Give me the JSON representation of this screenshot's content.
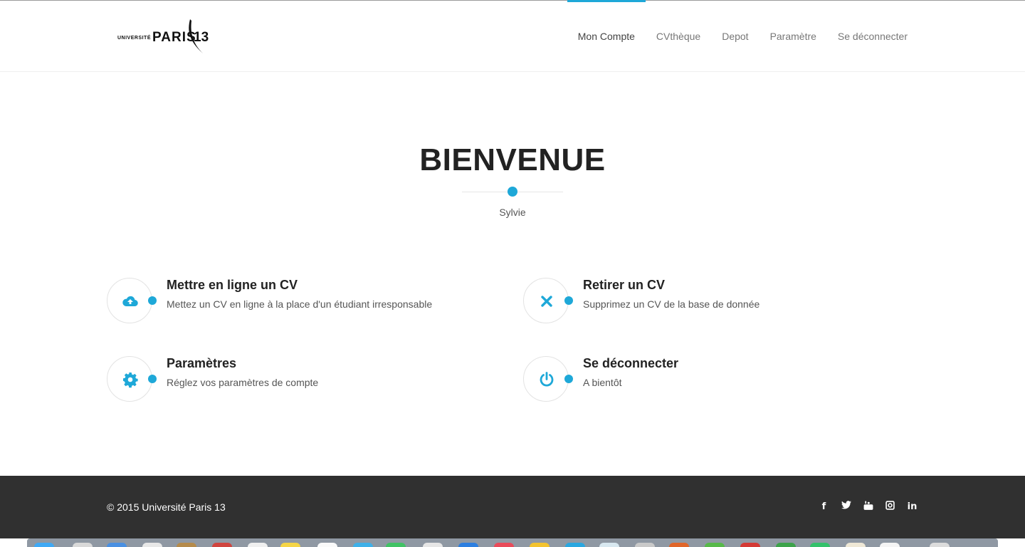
{
  "header": {
    "logo_small": "UNIVERSITÉ",
    "logo_big": "PARIS",
    "logo_num": "13",
    "nav": [
      {
        "label": "Mon Compte",
        "active": true
      },
      {
        "label": "CVthèque",
        "active": false
      },
      {
        "label": "Depot",
        "active": false
      },
      {
        "label": "Paramètre",
        "active": false
      },
      {
        "label": "Se déconnecter",
        "active": false
      }
    ]
  },
  "hero": {
    "title": "BIENVENUE",
    "subtitle": "Sylvie"
  },
  "features": [
    {
      "icon": "cloud-upload-icon",
      "title": "Mettre en ligne un CV",
      "desc": "Mettez un CV en ligne à la place d'un étudiant irresponsable"
    },
    {
      "icon": "close-icon",
      "title": "Retirer un CV",
      "desc": "Supprimez un CV de la base de donnée"
    },
    {
      "icon": "gear-icon",
      "title": "Paramètres",
      "desc": "Réglez vos paramètres de compte"
    },
    {
      "icon": "power-icon",
      "title": "Se déconnecter",
      "desc": "A bientôt"
    }
  ],
  "footer": {
    "copyright": "© 2015 Université Paris 13",
    "social": [
      "facebook-icon",
      "twitter-icon",
      "youtube-icon",
      "instagram-icon",
      "linkedin-icon"
    ]
  },
  "colors": {
    "accent": "#1ea8d8",
    "footer_bg": "#303030"
  }
}
